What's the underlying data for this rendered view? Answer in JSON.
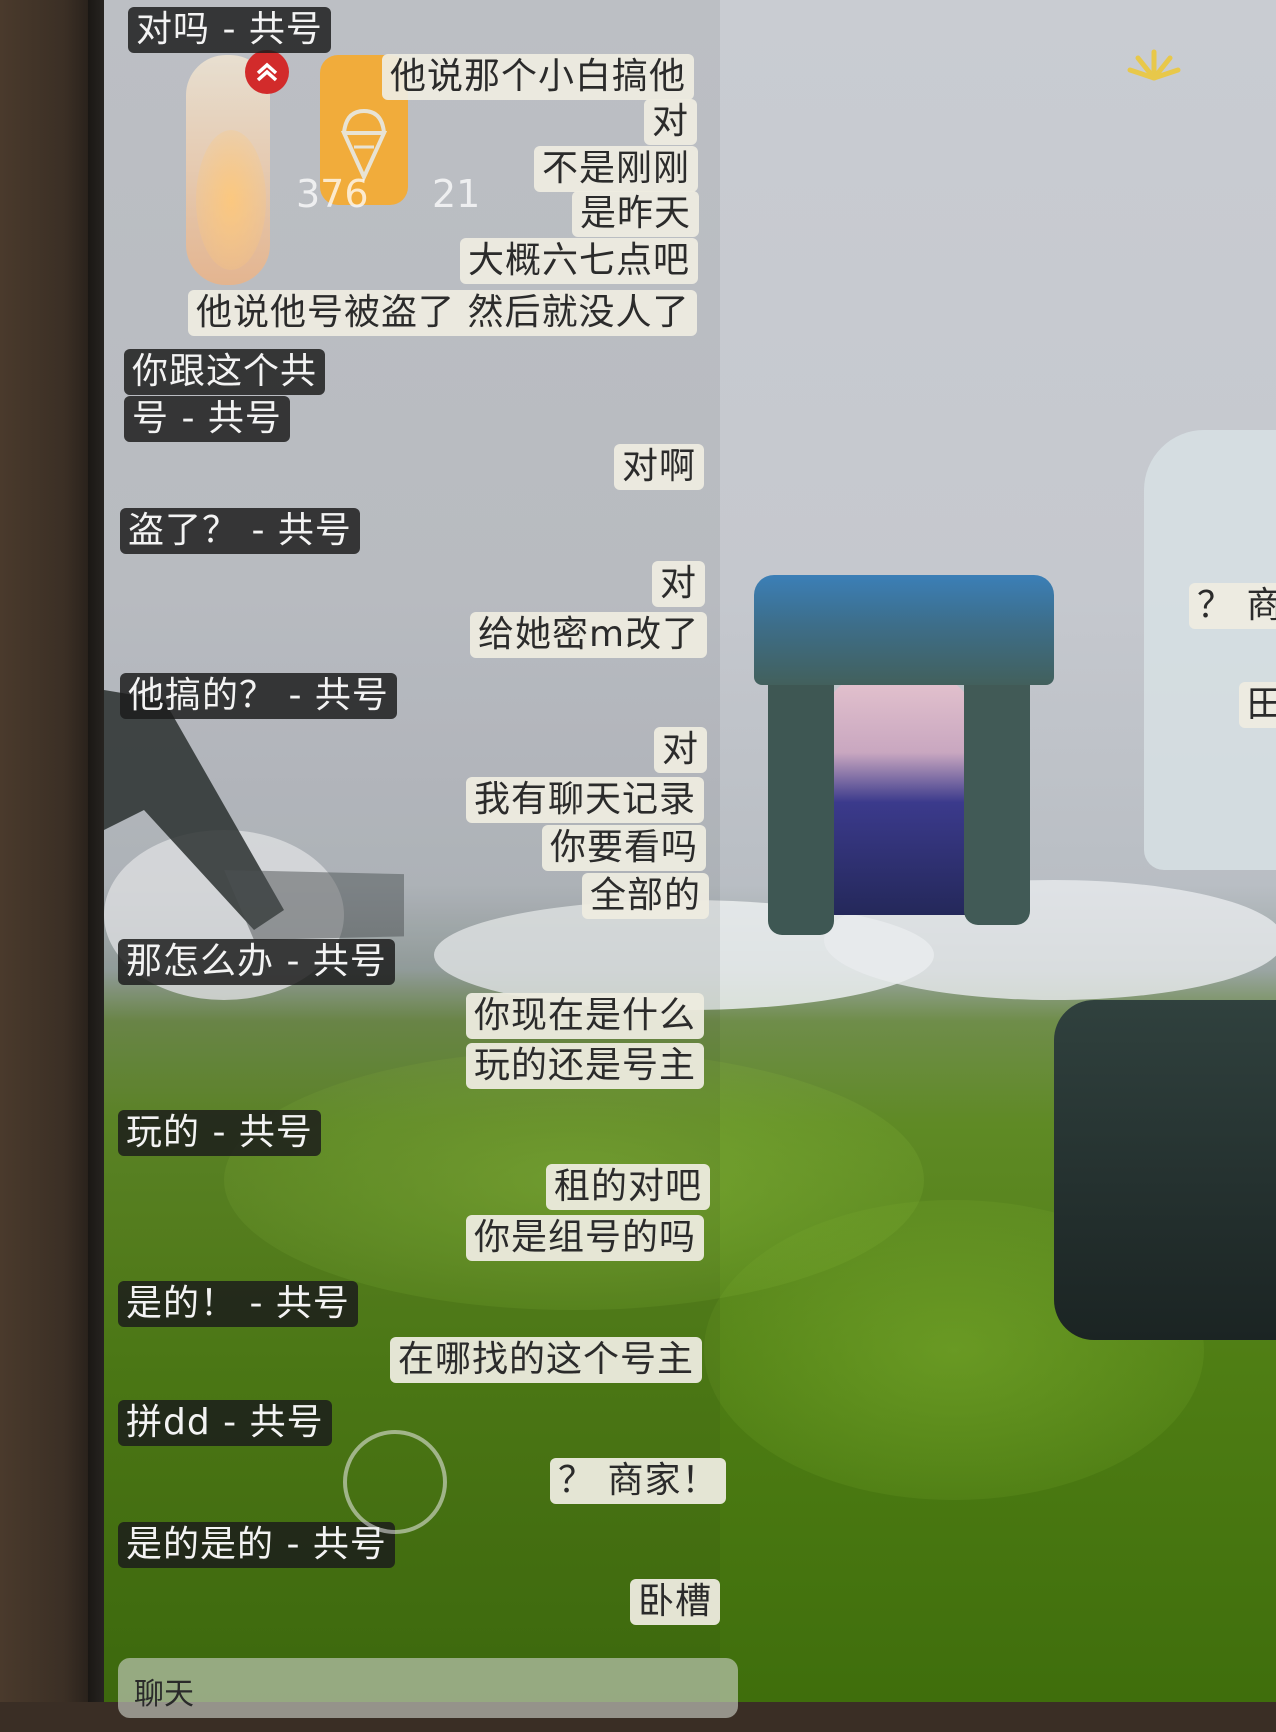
{
  "friend_stats": {
    "candles": "376",
    "hearts": "21"
  },
  "messages": [
    {
      "side": "in",
      "text": "对吗 - 共号"
    },
    {
      "side": "out",
      "text": "他说那个小白搞他"
    },
    {
      "side": "out",
      "text": "对"
    },
    {
      "side": "out",
      "text": "不是刚刚"
    },
    {
      "side": "out",
      "text": "是昨天"
    },
    {
      "side": "out",
      "text": "大概六七点吧"
    },
    {
      "side": "out",
      "text": "他说他号被盗了 然后就没人了"
    },
    {
      "side": "in",
      "text": "你跟这个共"
    },
    {
      "side": "in",
      "text": "号 - 共号"
    },
    {
      "side": "out",
      "text": "对啊"
    },
    {
      "side": "in",
      "text": "盗了？ - 共号"
    },
    {
      "side": "out",
      "text": "对"
    },
    {
      "side": "out",
      "text": "给她密m改了"
    },
    {
      "side": "in",
      "text": "他搞的？ - 共号"
    },
    {
      "side": "out",
      "text": "对"
    },
    {
      "side": "out",
      "text": "我有聊天记录"
    },
    {
      "side": "out",
      "text": "你要看吗"
    },
    {
      "side": "out",
      "text": "全部的"
    },
    {
      "side": "in",
      "text": "那怎么办 - 共号"
    },
    {
      "side": "out",
      "text": "你现在是什么"
    },
    {
      "side": "out",
      "text": "玩的还是号主"
    },
    {
      "side": "in",
      "text": "玩的 - 共号"
    },
    {
      "side": "out",
      "text": "租的对吧"
    },
    {
      "side": "out",
      "text": "你是组号的吗"
    },
    {
      "side": "in",
      "text": "是的！ - 共号"
    },
    {
      "side": "out",
      "text": "在哪找的这个号主"
    },
    {
      "side": "in",
      "text": "拼dd - 共号"
    },
    {
      "side": "out",
      "text": "？ 商家！"
    },
    {
      "side": "in",
      "text": "是的是的 - 共号"
    },
    {
      "side": "out",
      "text": "卧槽"
    }
  ],
  "scene_bubbles": [
    "？ 商",
    "田"
  ],
  "chat_input": {
    "placeholder": "聊天"
  },
  "colors": {
    "outgoing_bubble": "#eeece0",
    "incoming_bubble": "#1c1c1c",
    "grass": "#5a8a1e",
    "sky": "#c8cbd0",
    "gate_stone": "#3f5a55",
    "gate_top": "#3b7fb7"
  },
  "icons": [
    "chevron-up-icon",
    "ice-cream-icon",
    "candle-icon",
    "sun-icon",
    "joystick-icon"
  ]
}
